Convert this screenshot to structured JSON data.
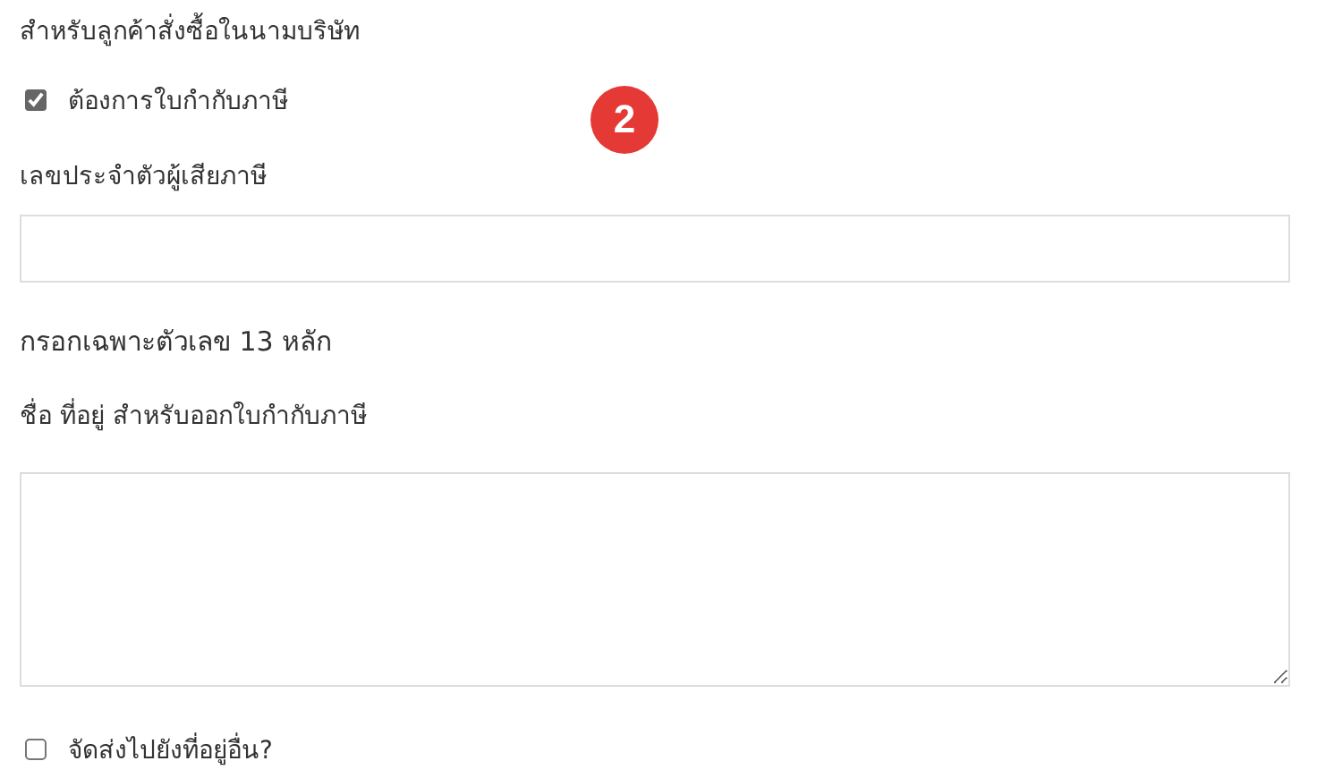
{
  "section_title": "สำหรับลูกค้าสั่งซื้อในนามบริษัท",
  "invoice_checkbox": {
    "label": "ต้องการใบกำกับภาษี",
    "checked": true
  },
  "tax_id": {
    "label": "เลขประจำตัวผู้เสียภาษี",
    "help": "กรอกเฉพาะตัวเลข 13 หลัก"
  },
  "address": {
    "label": "ชื่อ ที่อยู่ สำหรับออกใบกำกับภาษี"
  },
  "ship_checkbox": {
    "label": "จัดส่งไปยังที่อยู่อื่น?",
    "checked": false
  },
  "step_badge": "2"
}
